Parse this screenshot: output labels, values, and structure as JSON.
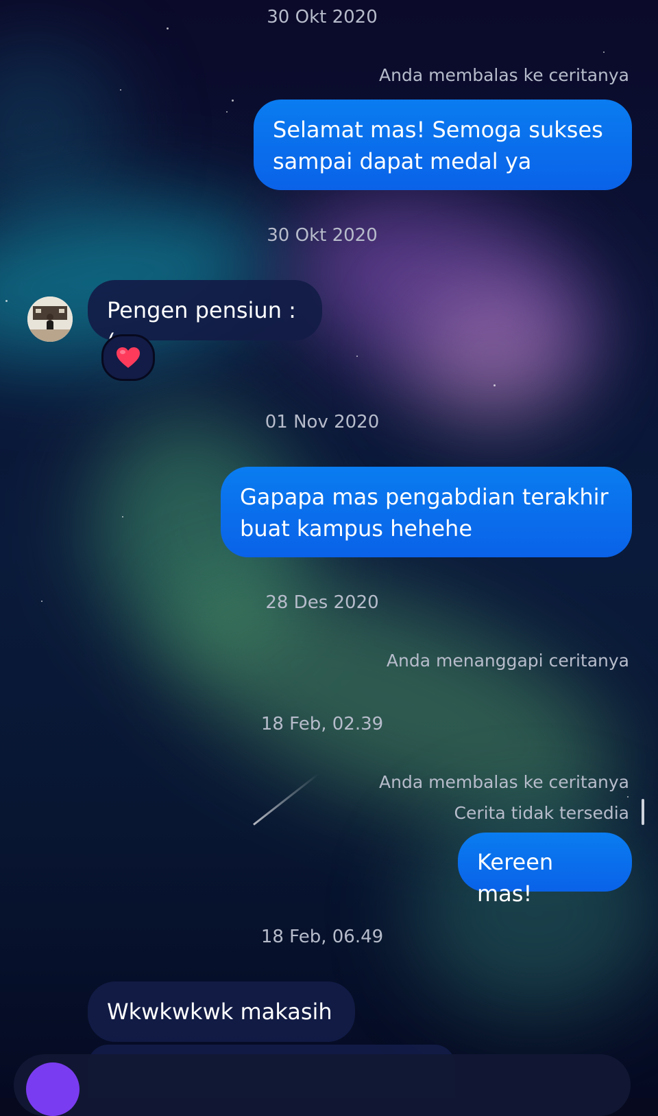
{
  "colors": {
    "outgoing_bubble": "#0a6fed",
    "incoming_bubble": "#121c46",
    "meta_text": "#b7bccb",
    "composer_accent": "#7a3cf0"
  },
  "thread": {
    "d1": "30 Okt 2020",
    "n1": "Anda membalas ke ceritanya",
    "m1": "Selamat mas! Semoga sukses sampai dapat medal ya",
    "d2": "30 Okt 2020",
    "m2": "Pengen pensiun :(",
    "m2_reaction": "heart-emoji",
    "d3": "01 Nov 2020",
    "m3": "Gapapa mas pengabdian terakhir buat kampus hehehe",
    "d4": "28 Des 2020",
    "n4": "Anda menanggapi ceritanya",
    "d5": "18 Feb, 02.39",
    "n5": "Anda membalas ke ceritanya",
    "n5_sub": "Cerita tidak tersedia",
    "m5": "Kereen mas!",
    "d6": "18 Feb, 06.49",
    "m6": "Wkwkwkwk makasih"
  }
}
